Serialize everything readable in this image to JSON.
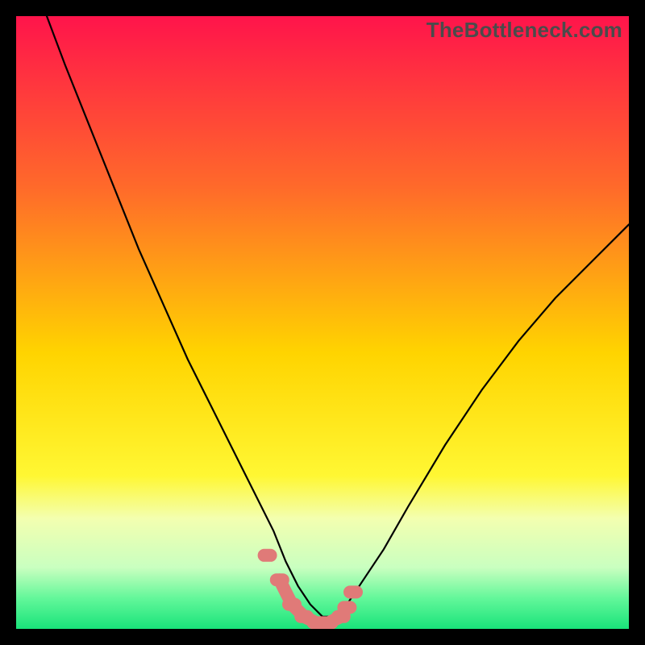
{
  "watermark": "TheBottleneck.com",
  "chart_data": {
    "type": "line",
    "title": "",
    "xlabel": "",
    "ylabel": "",
    "xlim": [
      0,
      100
    ],
    "ylim": [
      0,
      100
    ],
    "gradient_stops": [
      {
        "offset": 0.0,
        "color": "#ff144b"
      },
      {
        "offset": 0.28,
        "color": "#ff6a2a"
      },
      {
        "offset": 0.55,
        "color": "#ffd400"
      },
      {
        "offset": 0.75,
        "color": "#fff733"
      },
      {
        "offset": 0.82,
        "color": "#f3ffb0"
      },
      {
        "offset": 0.9,
        "color": "#c9ffc0"
      },
      {
        "offset": 0.95,
        "color": "#63f79a"
      },
      {
        "offset": 1.0,
        "color": "#19e37a"
      }
    ],
    "series": [
      {
        "name": "bottleneck-curve",
        "style": "black-line",
        "x": [
          5,
          8,
          12,
          16,
          20,
          24,
          28,
          32,
          36,
          40,
          42,
          44,
          46,
          48,
          50,
          52,
          54,
          56,
          60,
          64,
          70,
          76,
          82,
          88,
          94,
          100
        ],
        "y": [
          100,
          92,
          82,
          72,
          62,
          53,
          44,
          36,
          28,
          20,
          16,
          11,
          7,
          4,
          2,
          2,
          4,
          7,
          13,
          20,
          30,
          39,
          47,
          54,
          60,
          66
        ]
      },
      {
        "name": "optimal-markers",
        "style": "pink-rounded",
        "x": [
          41,
          43,
          45,
          47,
          49,
          51,
          53,
          54,
          55
        ],
        "y": [
          12,
          8,
          4,
          2,
          1,
          1,
          2,
          3.5,
          6
        ]
      }
    ]
  }
}
